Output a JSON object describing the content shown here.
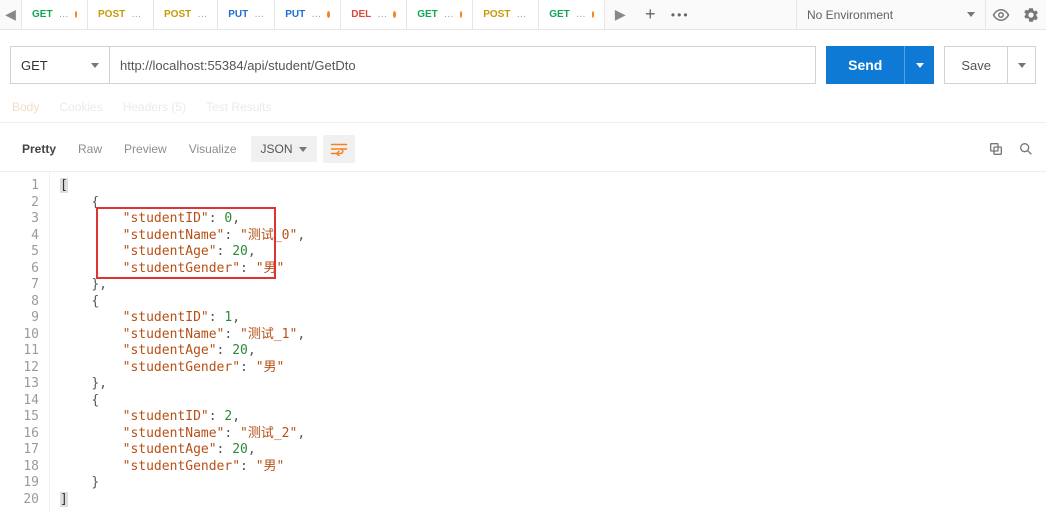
{
  "tabs": [
    {
      "method": "GET",
      "dirty": true
    },
    {
      "method": "POST",
      "dirty": true
    },
    {
      "method": "POST",
      "dirty": false
    },
    {
      "method": "PUT",
      "dirty": false
    },
    {
      "method": "PUT",
      "dirty": true
    },
    {
      "method": "DEL",
      "dirty": true
    },
    {
      "method": "GET",
      "dirty": true
    },
    {
      "method": "POST",
      "dirty": true
    },
    {
      "method": "GET",
      "dirty": true
    }
  ],
  "environment": {
    "label": "No Environment"
  },
  "request": {
    "method": "GET",
    "url": "http://localhost:55384/api/student/GetDto",
    "sendLabel": "Send",
    "saveLabel": "Save"
  },
  "reqSubtabs": {
    "body": "Body",
    "cookies": "Cookies",
    "headers": "Headers (5)",
    "tests": "Test Results"
  },
  "respTabs": {
    "pretty": "Pretty",
    "raw": "Raw",
    "preview": "Preview",
    "visualize": "Visualize",
    "format": "JSON"
  },
  "responseBody": [
    {
      "studentID": 0,
      "studentName": "测试_0",
      "studentAge": 20,
      "studentGender": "男"
    },
    {
      "studentID": 1,
      "studentName": "测试_1",
      "studentAge": 20,
      "studentGender": "男"
    },
    {
      "studentID": 2,
      "studentName": "测试_2",
      "studentAge": 20,
      "studentGender": "男"
    }
  ],
  "highlightBox": {
    "startLine": 3,
    "endLine": 6
  }
}
